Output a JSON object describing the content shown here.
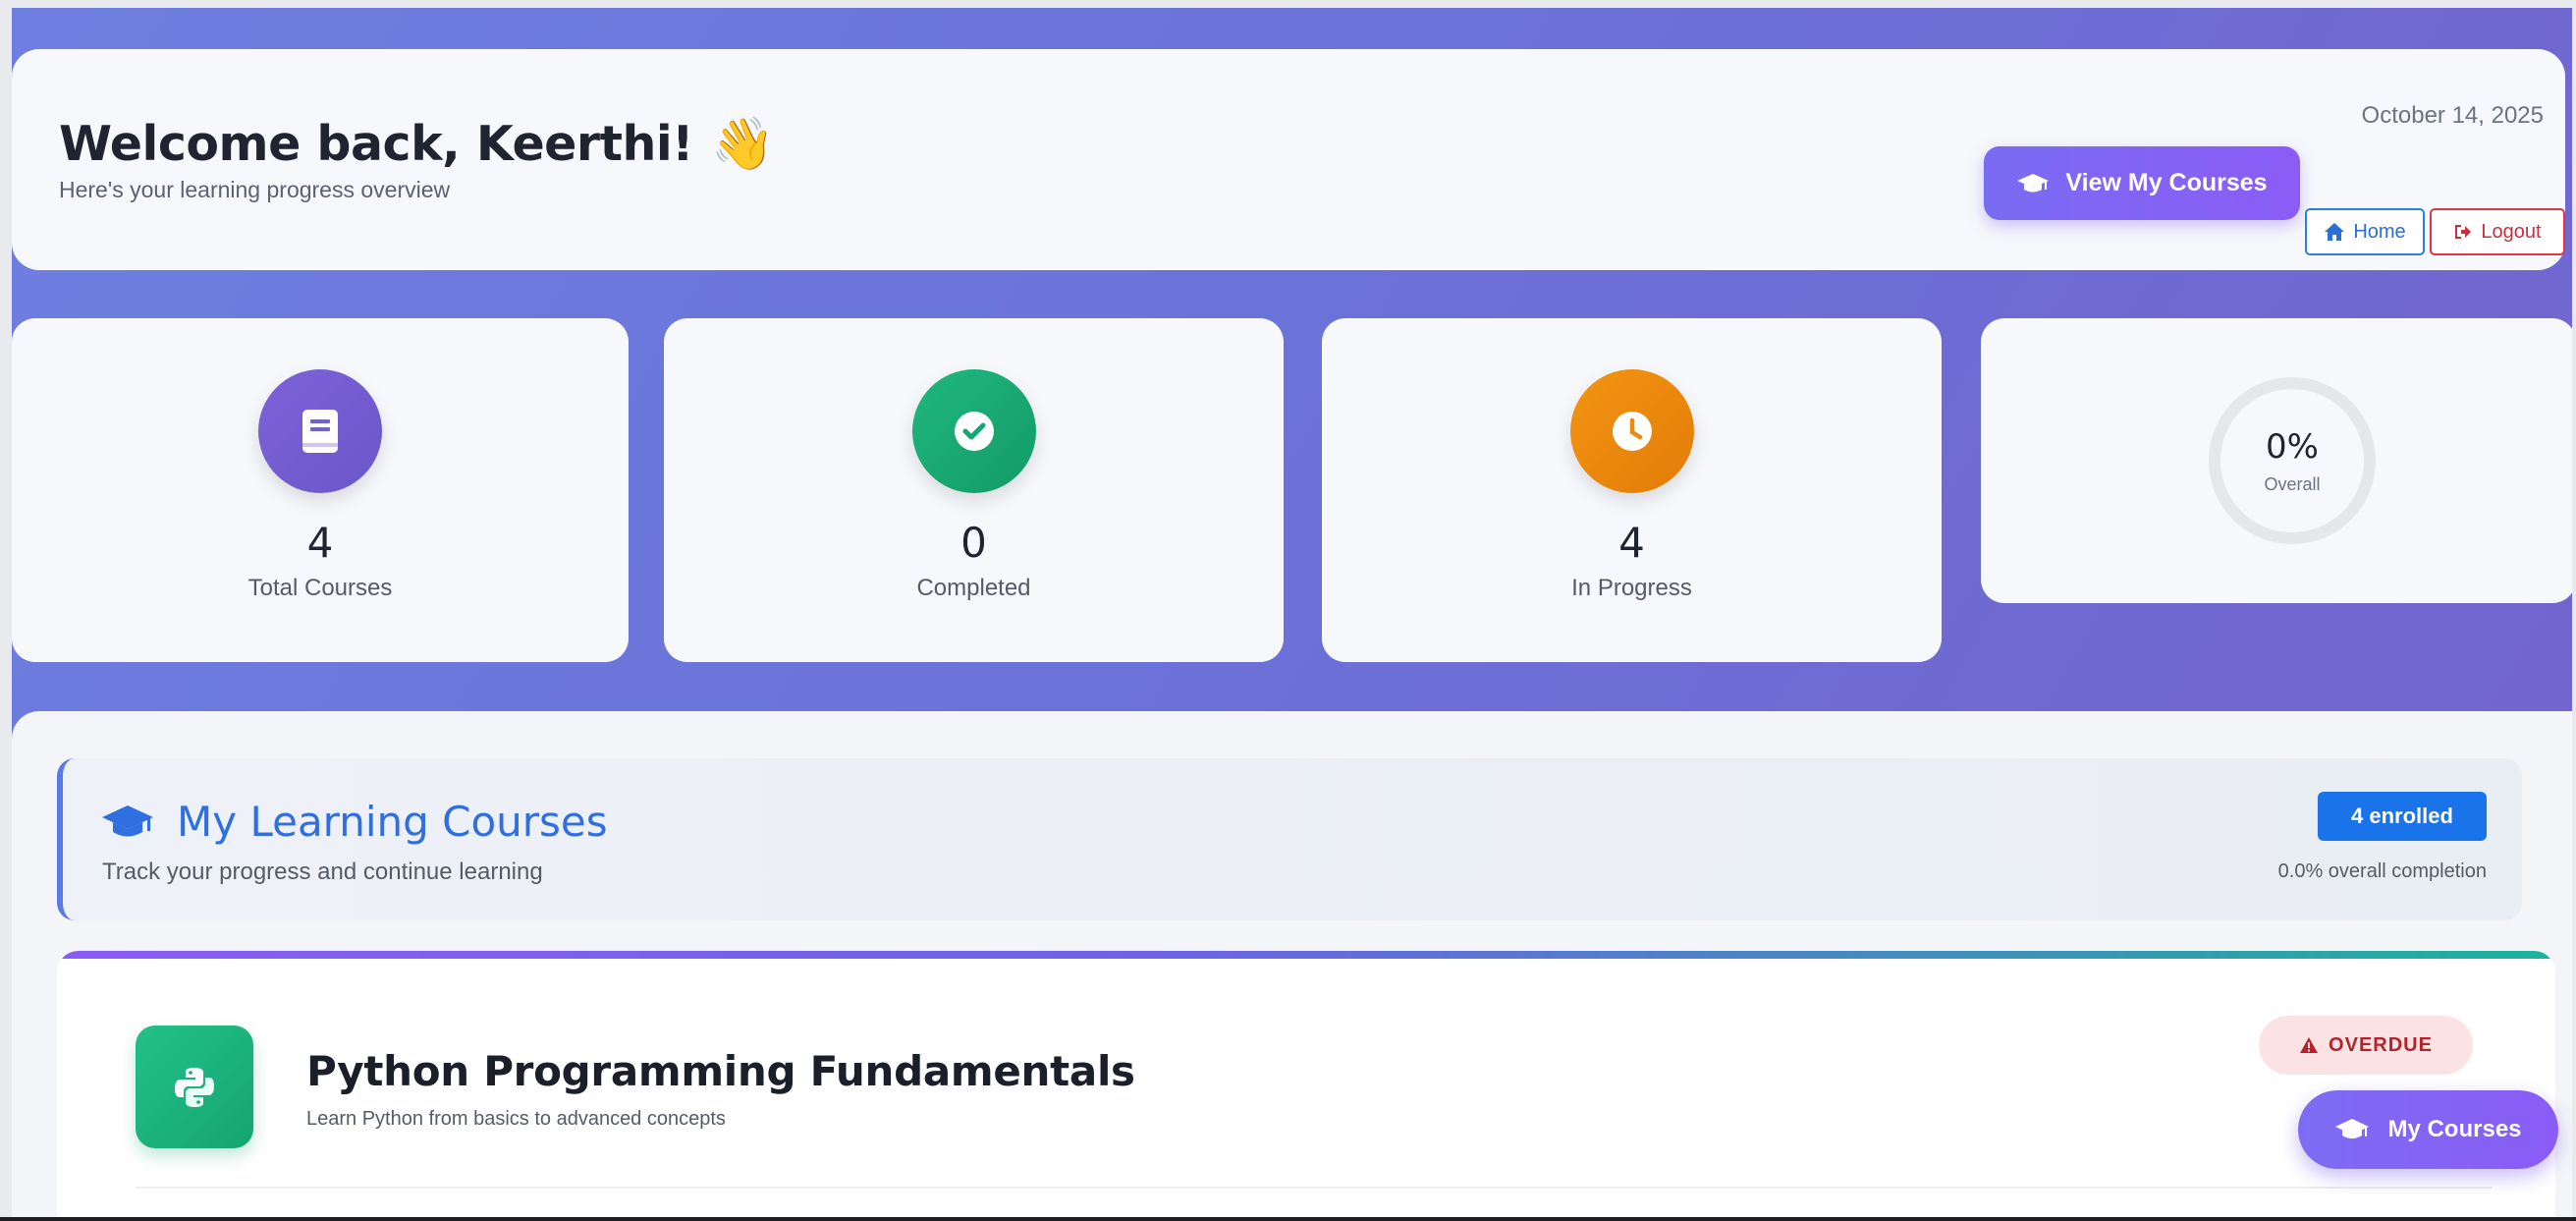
{
  "header": {
    "welcome": "Welcome back, Keerthi!",
    "wave_emoji": "👋",
    "subtitle": "Here's your learning progress overview",
    "date": "October 14, 2025",
    "view_courses_label": "View My Courses",
    "home_label": "Home",
    "logout_label": "Logout"
  },
  "stats": [
    {
      "value": "4",
      "label": "Total Courses",
      "icon": "book-icon",
      "color": "#7c5fd6"
    },
    {
      "value": "0",
      "label": "Completed",
      "icon": "check-circle-icon",
      "color": "#17a673"
    },
    {
      "value": "4",
      "label": "In Progress",
      "icon": "clock-icon",
      "color": "#ef8a0c"
    }
  ],
  "overall": {
    "value": "0%",
    "label": "Overall",
    "progress": 0
  },
  "courses_section": {
    "title": "My Learning Courses",
    "subtitle": "Track your progress and continue learning",
    "enrolled_badge": "4 enrolled",
    "completion_text": "0.0% overall completion"
  },
  "course": {
    "title": "Python Programming Fundamentals",
    "description": "Learn Python from basics to advanced concepts",
    "status_badge": "OVERDUE",
    "icon": "python-icon"
  },
  "fab": {
    "label": "My Courses"
  },
  "colors": {
    "accent": "#7a6cf2",
    "link_blue": "#1a73e8",
    "danger": "#dc3545"
  }
}
